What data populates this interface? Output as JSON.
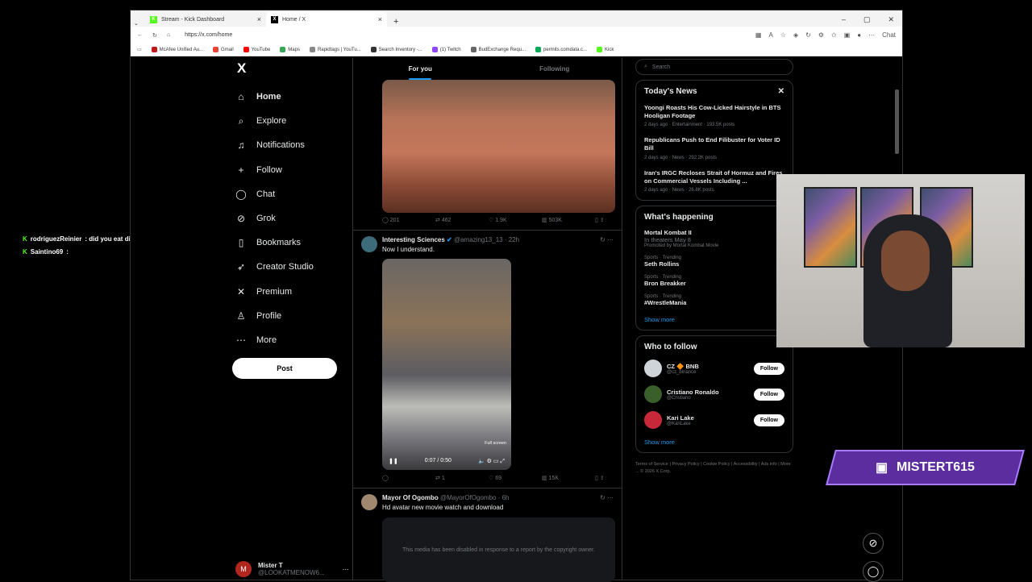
{
  "chat": [
    {
      "user": "rodriguezReinier",
      "text": ": did you eat dinner mr. t"
    },
    {
      "user": "Saintino69",
      "text": ":"
    }
  ],
  "browser": {
    "tabs": [
      {
        "title": "Stream - Kick Dashboard"
      },
      {
        "title": "Home / X"
      }
    ],
    "url": "https://x.com/home",
    "bookmarks": [
      "McAfee Unified Au...",
      "Gmail",
      "YouTube",
      "Maps",
      "Rapidtags | YouTu...",
      "Search Inventory -...",
      "(1) Twitch",
      "BudExchange Requ...",
      "permits.comdata.c...",
      "Kick"
    ],
    "chat_label": "Chat"
  },
  "nav": {
    "logo": "X",
    "items": [
      {
        "label": "Home",
        "icon": "home-icon",
        "g": "⌂"
      },
      {
        "label": "Explore",
        "icon": "search-icon",
        "g": "⌕"
      },
      {
        "label": "Notifications",
        "icon": "bell-icon",
        "g": "♫"
      },
      {
        "label": "Follow",
        "icon": "person-plus-icon",
        "g": "+"
      },
      {
        "label": "Chat",
        "icon": "chat-icon",
        "g": "◯"
      },
      {
        "label": "Grok",
        "icon": "grok-icon",
        "g": "⊘"
      },
      {
        "label": "Bookmarks",
        "icon": "bookmark-icon",
        "g": "▯"
      },
      {
        "label": "Creator Studio",
        "icon": "rocket-icon",
        "g": "➶"
      },
      {
        "label": "Premium",
        "icon": "x-icon",
        "g": "✕"
      },
      {
        "label": "Profile",
        "icon": "person-icon",
        "g": "♙"
      },
      {
        "label": "More",
        "icon": "more-icon",
        "g": "⋯"
      }
    ],
    "post": "Post",
    "user": {
      "name": "Mister T",
      "handle": "@LOOKATMENOW6...",
      "initial": "M"
    }
  },
  "feed": {
    "tabs": [
      "For you",
      "Following"
    ],
    "tweet1_actions": [
      "201",
      "462",
      "1.9K",
      "503K"
    ],
    "tweet2": {
      "name": "Interesting Sciences",
      "handle": "@amazing13_13 · 22h",
      "text": "Now I understand.",
      "fullscreen": "Full screen",
      "time": "0:07 / 0:50",
      "actions": [
        "",
        "1",
        "69",
        "15K"
      ]
    },
    "tweet3": {
      "name": "Mayor Of Ogombo",
      "handle": "@MayorOfOgombo · 6h",
      "text": "Hd avatar new movie watch and download",
      "media": "This media has been disabled in response to a report by the copyright owner."
    }
  },
  "sidebar": {
    "search": "Search",
    "news_title": "Today's News",
    "news": [
      {
        "title": "Yoongi Roasts His Cow-Licked Hairstyle in BTS Hooligan Footage",
        "meta": "2 days ago · Entertainment · 193.5K posts"
      },
      {
        "title": "Republicans Push to End Filibuster for Voter ID Bill",
        "meta": "2 days ago · News · 292.2K posts"
      },
      {
        "title": "Iran's IRGC Recloses Strait of Hormuz and Fires on Commercial Vessels Including ...",
        "meta": "2 days ago · News · 26.8K posts"
      }
    ],
    "happening_title": "What's happening",
    "trends": [
      {
        "top": "Mortal Kombat II",
        "title": "In theaters May 8",
        "sub": "Promoted by Mortal Kombat Movie"
      },
      {
        "top": "Sports · Trending",
        "title": "Seth Rollins",
        "sub": ""
      },
      {
        "top": "Sports · Trending",
        "title": "Bron Breakker",
        "sub": ""
      },
      {
        "top": "Sports · Trending",
        "title": "#WrestleMania",
        "sub": ""
      }
    ],
    "show_more": "Show more",
    "who_title": "Who to follow",
    "who": [
      {
        "name": "CZ 🔶 BNB",
        "handle": "@cz_binance",
        "btn": "Follow"
      },
      {
        "name": "Cristiano Ronaldo",
        "handle": "@Cristiano",
        "btn": "Follow"
      },
      {
        "name": "Kari Lake",
        "handle": "@KariLake",
        "btn": "Follow"
      }
    ],
    "footer": "Terms of Service | Privacy Policy | Cookie Policy | Accessibility | Ads info | More ... © 2026 X Corp."
  },
  "overlay": {
    "channel": "MISTERT615"
  }
}
